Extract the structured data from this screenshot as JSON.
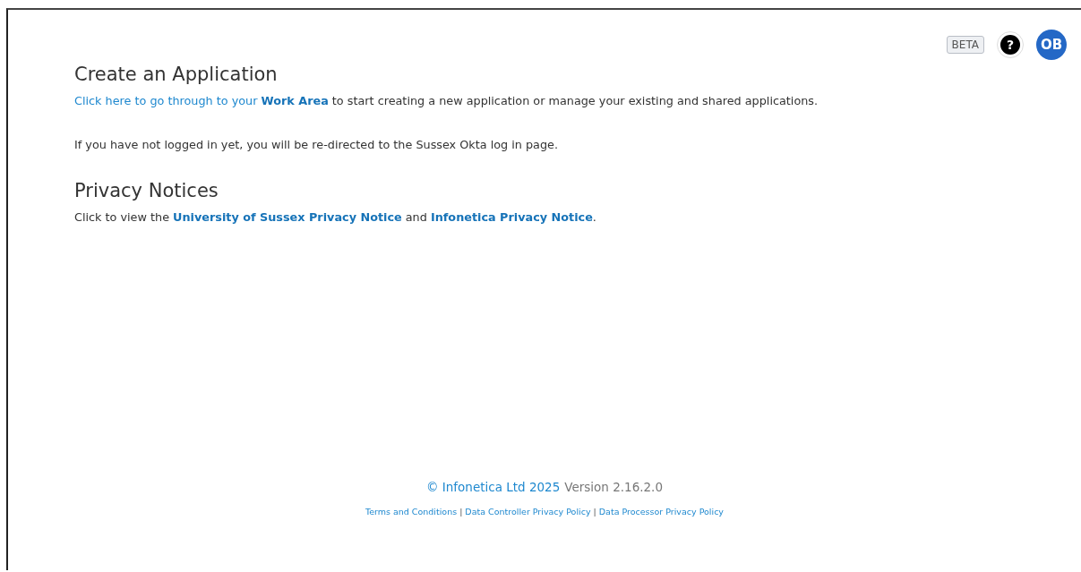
{
  "header": {
    "badge": "BETA",
    "help": "?",
    "avatar": "OB"
  },
  "sections": [
    {
      "title": "Create an Application",
      "paragraphs": [
        [
          {
            "text": "Click here to go through to your **Work Area**",
            "link": true
          },
          {
            "text": " to start creating a new application or manage your existing and shared applications.",
            "link": false
          }
        ],
        [
          {
            "text": "If you have not logged in yet, you will be re-directed to the Sussex Okta log in page.",
            "link": false
          }
        ]
      ]
    },
    {
      "title": "Privacy Notices",
      "paragraphs": [
        [
          {
            "text": "Click to view the ",
            "link": false
          },
          {
            "text": "**University of Sussex Privacy Notice**",
            "link": true
          },
          {
            "text": " and ",
            "link": false
          },
          {
            "text": "**Infonetica Privacy Notice**",
            "link": true
          },
          {
            "text": ".",
            "link": false
          }
        ]
      ]
    }
  ],
  "footer": {
    "copyright": "© Infonetica Ltd 2025",
    "version": "Version 2.16.2.0",
    "links": [
      "Terms and Conditions",
      "Data Controller Privacy Policy",
      "Data Processor Privacy Policy"
    ],
    "separator": "|"
  }
}
